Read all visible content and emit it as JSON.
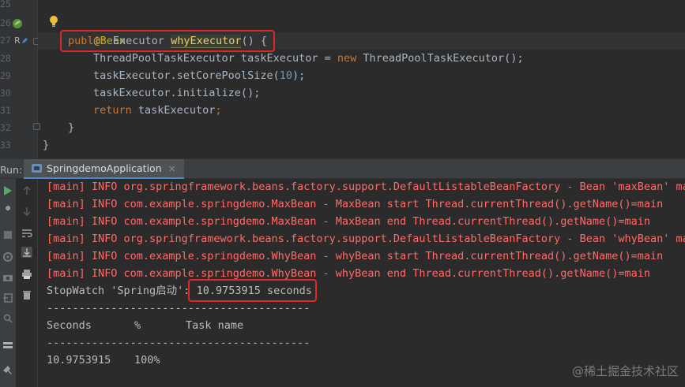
{
  "editor": {
    "line_numbers": [
      "25",
      "26",
      "27",
      "28",
      "29",
      "30",
      "31",
      "32",
      "33"
    ],
    "lines": [
      {
        "annotation": "@Bean"
      },
      {
        "kw1": "public ",
        "type": "Executor ",
        "method": "whyExecutor",
        "rest": "() {"
      },
      {
        "text1": "ThreadPoolTaskExecutor taskExecutor = ",
        "kw": "new ",
        "text2": "ThreadPoolTaskExecutor();"
      },
      {
        "text1": "taskExecutor.setCorePoolSize(",
        "num": "10",
        "text2": ");"
      },
      {
        "text1": "taskExecutor.initialize();"
      },
      {
        "kw": "return ",
        "text1": "taskExecutor",
        "semi": ";"
      },
      {
        "text1": "}"
      },
      {
        "text1": "}"
      }
    ],
    "gutter_marker": "R"
  },
  "run_panel": {
    "label": "Run:",
    "tab_title": "SpringdemoApplication",
    "tab_close": "×"
  },
  "console": {
    "log_lines": [
      "[main] INFO org.springframework.beans.factory.support.DefaultListableBeanFactory - Bean 'maxBean' mar",
      "[main] INFO com.example.springdemo.MaxBean - MaxBean start Thread.currentThread().getName()=main",
      "[main] INFO com.example.springdemo.MaxBean - MaxBean end Thread.currentThread().getName()=main",
      "[main] INFO org.springframework.beans.factory.support.DefaultListableBeanFactory - Bean 'whyBean' mar",
      "[main] INFO com.example.springdemo.WhyBean - whyBean start Thread.currentThread().getName()=main",
      "[main] INFO com.example.springdemo.WhyBean - whyBean end Thread.currentThread().getName()=main"
    ],
    "stopwatch_prefix": "StopWatch 'Spring启动': ",
    "stopwatch_value": "10.9753915 seconds",
    "separator": "-----------------------------------------",
    "header_seconds": "Seconds",
    "header_percent": "%",
    "header_task": "Task name",
    "row_seconds": "10.9753915",
    "row_percent": "100%"
  },
  "watermark": "@稀土掘金技术社区",
  "colors": {
    "keyword": "#cc7832",
    "annotation": "#bbb529",
    "method": "#ffc66d",
    "number": "#6897bb",
    "log_text": "#ff6b68",
    "highlight_box": "#e02828",
    "tab_underline": "#4a88c7"
  }
}
